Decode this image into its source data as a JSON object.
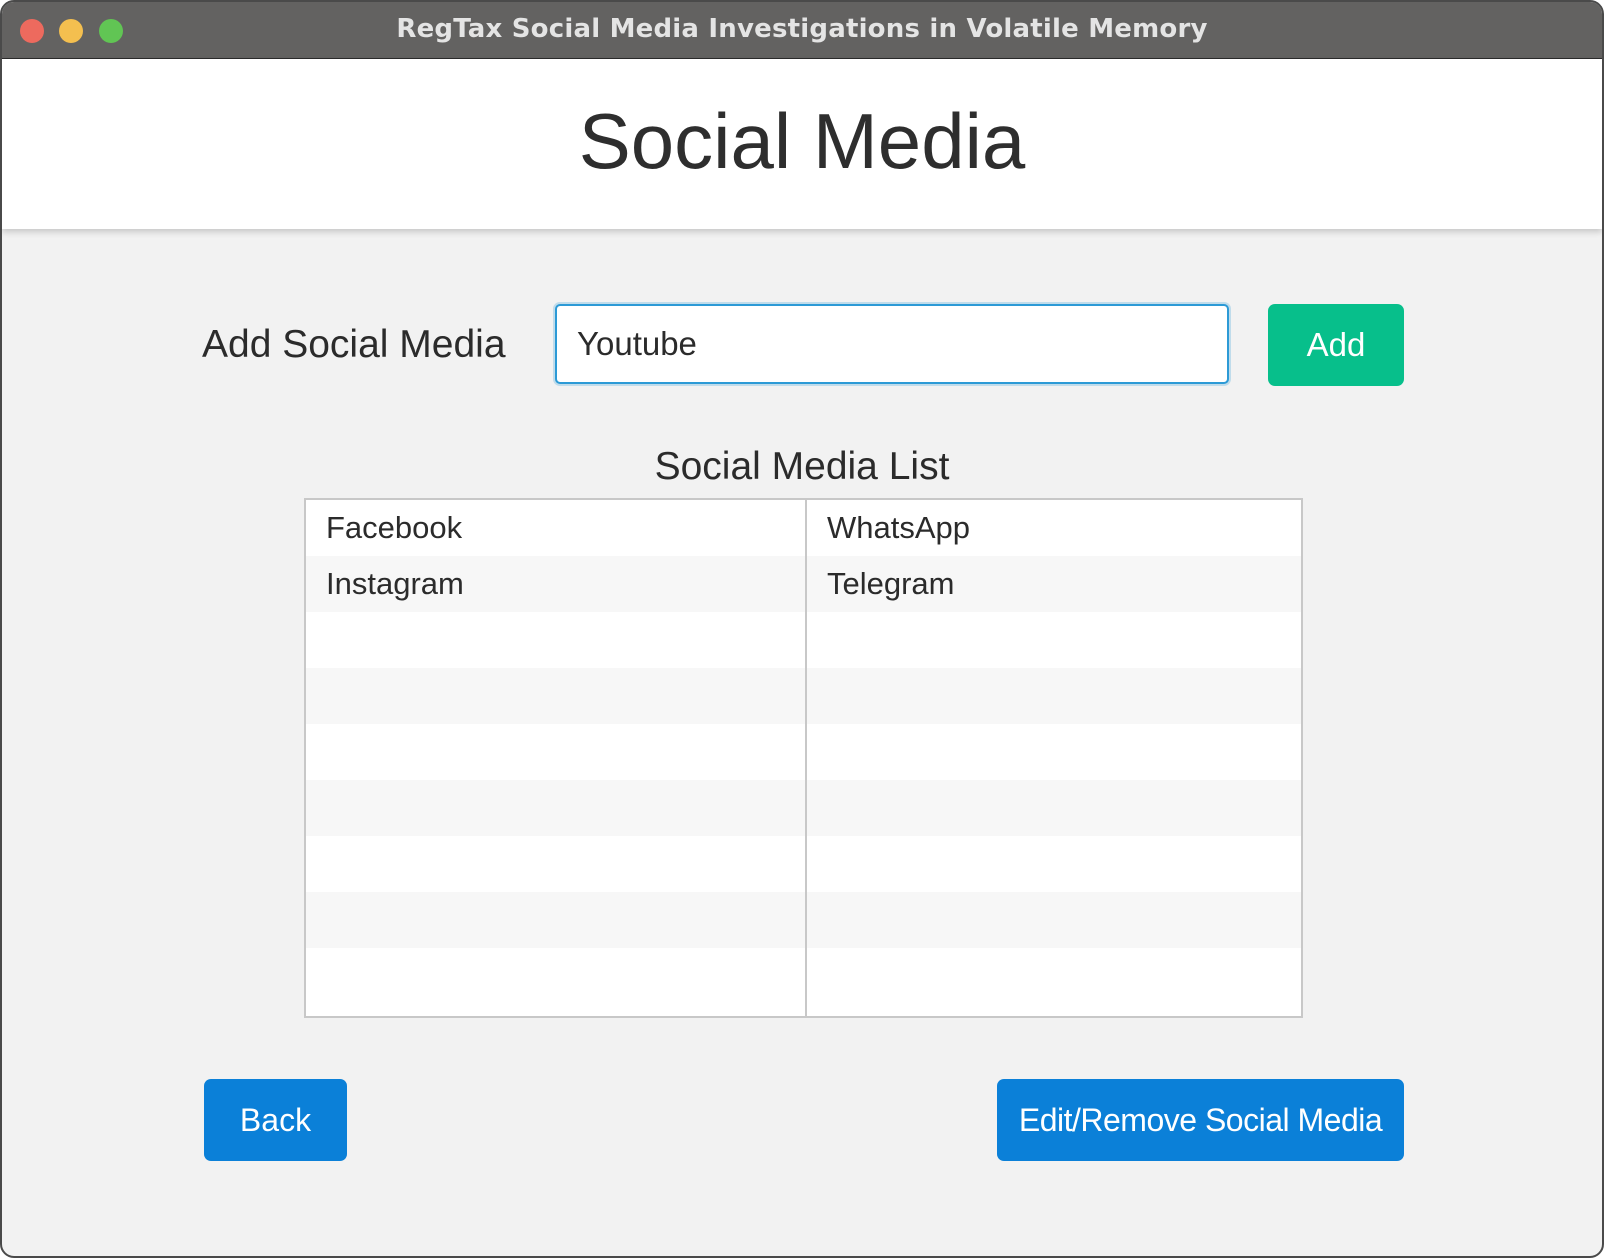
{
  "window": {
    "title": "RegTax Social Media Investigations in Volatile Memory",
    "controls": [
      "close",
      "minimize",
      "zoom"
    ]
  },
  "header": {
    "title": "Social Media"
  },
  "add_section": {
    "label": "Add Social Media",
    "input_value": "Youtube",
    "add_button_label": "Add"
  },
  "list_section": {
    "title": "Social Media List",
    "left_column": [
      "Facebook",
      "Instagram",
      "",
      "",
      "",
      "",
      "",
      "",
      ""
    ],
    "right_column": [
      "WhatsApp",
      "Telegram",
      "",
      "",
      "",
      "",
      "",
      "",
      ""
    ]
  },
  "footer": {
    "back_label": "Back",
    "edit_remove_label": "Edit/Remove Social Media"
  },
  "colors": {
    "titlebar": "#636261",
    "add_button": "#07bf8b",
    "primary_button": "#0b80d8",
    "input_focus_border": "#2c9ad6",
    "background": "#f2f2f2"
  }
}
